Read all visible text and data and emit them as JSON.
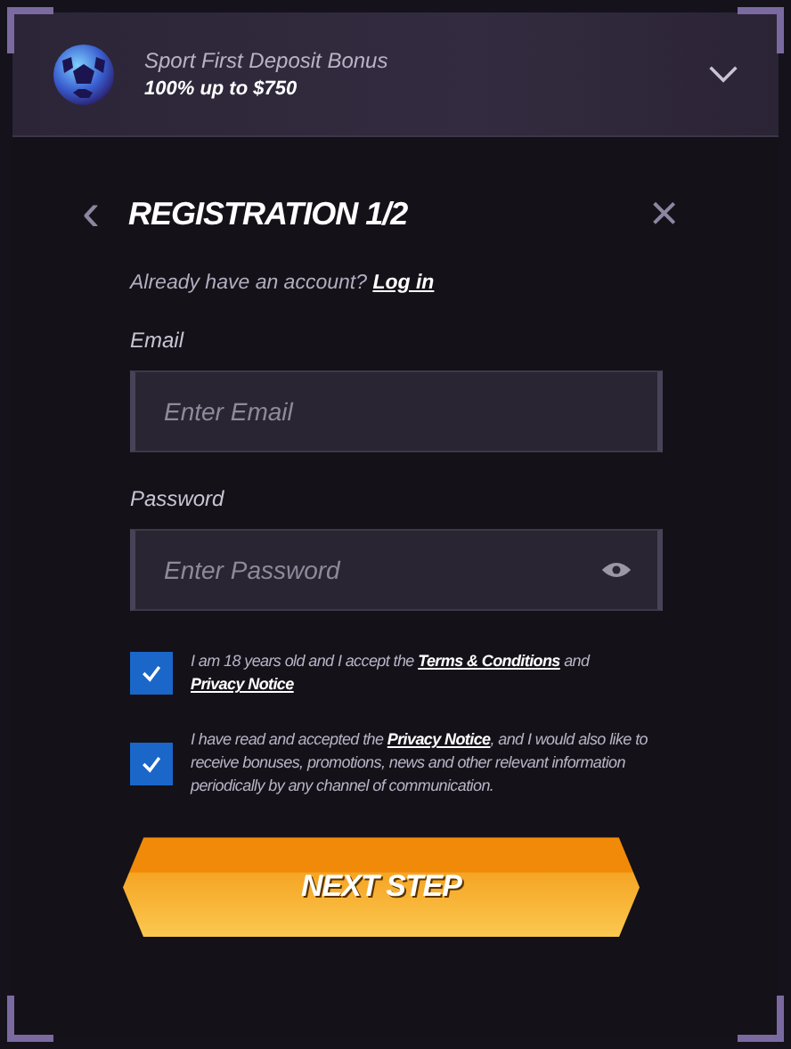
{
  "bonus": {
    "title": "Sport First Deposit Bonus",
    "subtitle": "100% up to $750",
    "expanded": false
  },
  "dialog": {
    "title": "REGISTRATION 1/2",
    "back_label": "‹",
    "close_label": "×"
  },
  "login_prompt": {
    "text": "Already have an account?",
    "link": "Log in"
  },
  "fields": [
    {
      "label": "Email",
      "placeholder": "Enter Email",
      "kind": "text"
    },
    {
      "label": "Password",
      "placeholder": "Enter Password",
      "kind": "password"
    }
  ],
  "consents": [
    {
      "checked": true,
      "parts": [
        {
          "kind": "text",
          "text": "I am 18 years old and I accept the "
        },
        {
          "kind": "link",
          "text": "Terms & Conditions"
        },
        {
          "kind": "text",
          "text": " and "
        },
        {
          "kind": "link",
          "text": "Privacy Notice"
        }
      ]
    },
    {
      "checked": true,
      "parts": [
        {
          "kind": "text",
          "text": "I have read and accepted the "
        },
        {
          "kind": "link",
          "text": "Privacy Notice"
        },
        {
          "kind": "text",
          "text": ", and I would also like to receive bonuses, promotions, news and other relevant information periodically by any channel of communication."
        }
      ]
    }
  ],
  "next_button": "NEXT STEP"
}
